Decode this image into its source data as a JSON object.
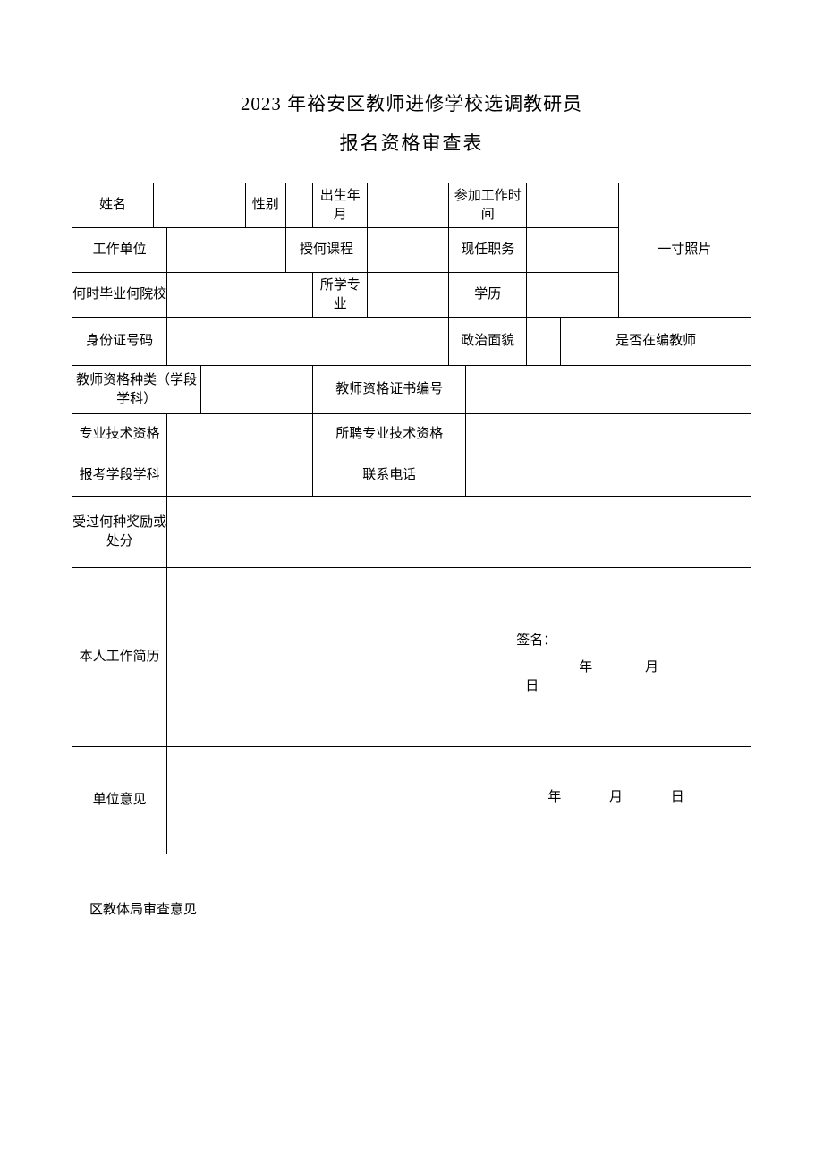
{
  "title": {
    "line1": "2023 年裕安区教师进修学校选调教研员",
    "line2": "报名资格审查表"
  },
  "labels": {
    "name": "姓名",
    "gender": "性别",
    "birth": "出生年月",
    "join_work": "参加工作时间",
    "photo": "一寸照片",
    "work_unit": "工作单位",
    "teach_course": "授何课程",
    "current_post": "现任职务",
    "grad_school": "何时毕业何院校",
    "major": "所学专业",
    "education": "学历",
    "id_number": "身份证号码",
    "political": "政治面貌",
    "is_regular_teacher": "是否在编教师",
    "cert_type": "教师资格种类（学段学科）",
    "cert_no": "教师资格证书编号",
    "pro_title": "专业技术资格",
    "hired_title": "所聘专业技术资格",
    "apply_subject": "报考学段学科",
    "phone": "联系电话",
    "awards": "受过何种奖励或处分",
    "resume": "本人工作简历",
    "signature": "签名：",
    "year": "年",
    "month": "月",
    "day": "日",
    "unit_opinion": "单位意见"
  },
  "values": {
    "name": "",
    "gender": "",
    "birth": "",
    "join_work": "",
    "work_unit": "",
    "teach_course": "",
    "current_post": "",
    "grad_school": "",
    "major": "",
    "education": "",
    "id_number": "",
    "political": "",
    "is_regular_teacher": "",
    "cert_type": "",
    "cert_no": "",
    "pro_title": "",
    "hired_title": "",
    "apply_subject": "",
    "phone": "",
    "awards": "",
    "resume": "",
    "unit_opinion": ""
  },
  "footer": {
    "review": "区教体局审查意见"
  }
}
